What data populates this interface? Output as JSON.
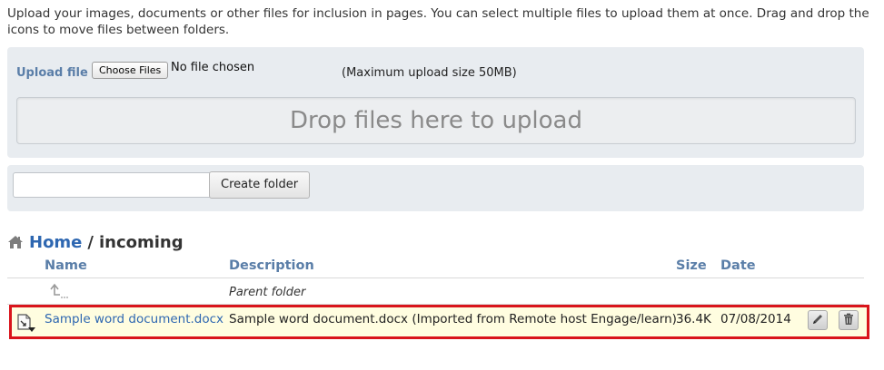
{
  "intro_text": "Upload your images, documents or other files for inclusion in pages. You can select multiple files to upload them at once. Drag and drop the icons to move files between folders.",
  "upload": {
    "label": "Upload file",
    "choose_button": "Choose Files",
    "no_file_text": "No file chosen",
    "max_size_text": "(Maximum upload size 50MB)",
    "dropzone_text": "Drop files here to upload"
  },
  "folder": {
    "input_value": "",
    "create_button": "Create folder"
  },
  "breadcrumb": {
    "home": "Home",
    "separator": "/",
    "current": "incoming",
    "icon": "home-icon"
  },
  "table": {
    "headers": {
      "name": "Name",
      "description": "Description",
      "size": "Size",
      "date": "Date"
    },
    "parent_row": {
      "icon": "parent-folder-icon",
      "description": "Parent folder"
    },
    "rows": [
      {
        "name": "Sample word document.docx",
        "description": "Sample word document.docx (Imported from Remote host Engage/learn)",
        "size": "36.4K",
        "date": "07/08/2014",
        "icon": "document-icon",
        "actions": [
          "edit-icon",
          "delete-icon"
        ]
      }
    ]
  },
  "colors": {
    "accent": "#2e67b1",
    "header_text": "#5a7ea8",
    "panel_bg": "#e8ecf0",
    "highlight_border": "#d9141b",
    "row_highlight": "#fffde0"
  }
}
